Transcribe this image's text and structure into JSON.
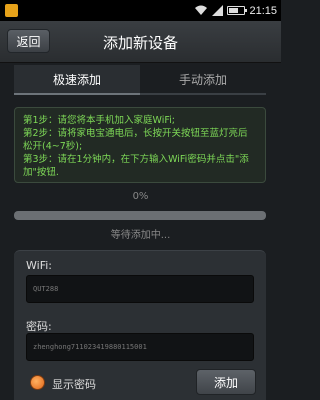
{
  "status_bar": {
    "time": "21:15"
  },
  "header": {
    "back_label": "返回",
    "title": "添加新设备"
  },
  "tabs": [
    {
      "label": "极速添加",
      "active": true
    },
    {
      "label": "手动添加",
      "active": false
    }
  ],
  "instructions": [
    "第1步：请您将本手机加入家庭WiFi;",
    "第2步：请将家电宝通电后，长按开关按钮至蓝灯亮后松开(4~7秒);",
    "第3步：请在1分钟内，在下方输入WiFi密码并点击\"添加\"按钮."
  ],
  "progress": {
    "text": "0%",
    "value": 0,
    "status": "等待添加中..."
  },
  "form": {
    "wifi_label": "WiFi:",
    "wifi_value": "QUT288",
    "password_label": "密码:",
    "password_value": "zhenghong711023419880115001",
    "show_password_label": "显示密码",
    "add_label": "添加"
  },
  "colors": {
    "accent_green": "#7ed957",
    "toggle_orange": "#e0661a"
  }
}
